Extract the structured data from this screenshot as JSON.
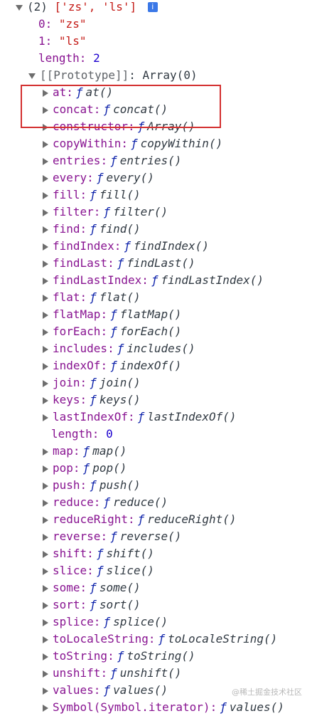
{
  "header": {
    "count_text": "(2)",
    "preview": "['zs', 'ls']",
    "info_icon": "info-icon"
  },
  "elements": [
    {
      "index": "0",
      "value": "\"zs\""
    },
    {
      "index": "1",
      "value": "\"ls\""
    }
  ],
  "length": {
    "key": "length",
    "value": "2"
  },
  "prototype": {
    "label": "[[Prototype]]",
    "value": "Array(0)"
  },
  "methods": [
    {
      "key": "at",
      "fn": "at()"
    },
    {
      "key": "concat",
      "fn": "concat()"
    },
    {
      "key": "constructor",
      "fn": "Array()"
    },
    {
      "key": "copyWithin",
      "fn": "copyWithin()"
    },
    {
      "key": "entries",
      "fn": "entries()"
    },
    {
      "key": "every",
      "fn": "every()"
    },
    {
      "key": "fill",
      "fn": "fill()"
    },
    {
      "key": "filter",
      "fn": "filter()"
    },
    {
      "key": "find",
      "fn": "find()"
    },
    {
      "key": "findIndex",
      "fn": "findIndex()"
    },
    {
      "key": "findLast",
      "fn": "findLast()"
    },
    {
      "key": "findLastIndex",
      "fn": "findLastIndex()"
    },
    {
      "key": "flat",
      "fn": "flat()"
    },
    {
      "key": "flatMap",
      "fn": "flatMap()"
    },
    {
      "key": "forEach",
      "fn": "forEach()"
    },
    {
      "key": "includes",
      "fn": "includes()"
    },
    {
      "key": "indexOf",
      "fn": "indexOf()"
    },
    {
      "key": "join",
      "fn": "join()"
    },
    {
      "key": "keys",
      "fn": "keys()"
    },
    {
      "key": "lastIndexOf",
      "fn": "lastIndexOf()"
    }
  ],
  "proto_length": {
    "key": "length",
    "value": "0"
  },
  "methods2": [
    {
      "key": "map",
      "fn": "map()"
    },
    {
      "key": "pop",
      "fn": "pop()"
    },
    {
      "key": "push",
      "fn": "push()"
    },
    {
      "key": "reduce",
      "fn": "reduce()"
    },
    {
      "key": "reduceRight",
      "fn": "reduceRight()"
    },
    {
      "key": "reverse",
      "fn": "reverse()"
    },
    {
      "key": "shift",
      "fn": "shift()"
    },
    {
      "key": "slice",
      "fn": "slice()"
    },
    {
      "key": "some",
      "fn": "some()"
    },
    {
      "key": "sort",
      "fn": "sort()"
    },
    {
      "key": "splice",
      "fn": "splice()"
    },
    {
      "key": "toLocaleString",
      "fn": "toLocaleString()"
    },
    {
      "key": "toString",
      "fn": "toString()"
    },
    {
      "key": "unshift",
      "fn": "unshift()"
    },
    {
      "key": "values",
      "fn": "values()"
    },
    {
      "key": "Symbol(Symbol.iterator)",
      "fn": "values()"
    }
  ],
  "function_symbol": "ƒ",
  "colon": ":",
  "watermark": "@稀土掘金技术社区",
  "colors": {
    "key": "#881391",
    "string": "#c41a16",
    "number": "#1c00cf",
    "highlight": "#d32f2f"
  }
}
